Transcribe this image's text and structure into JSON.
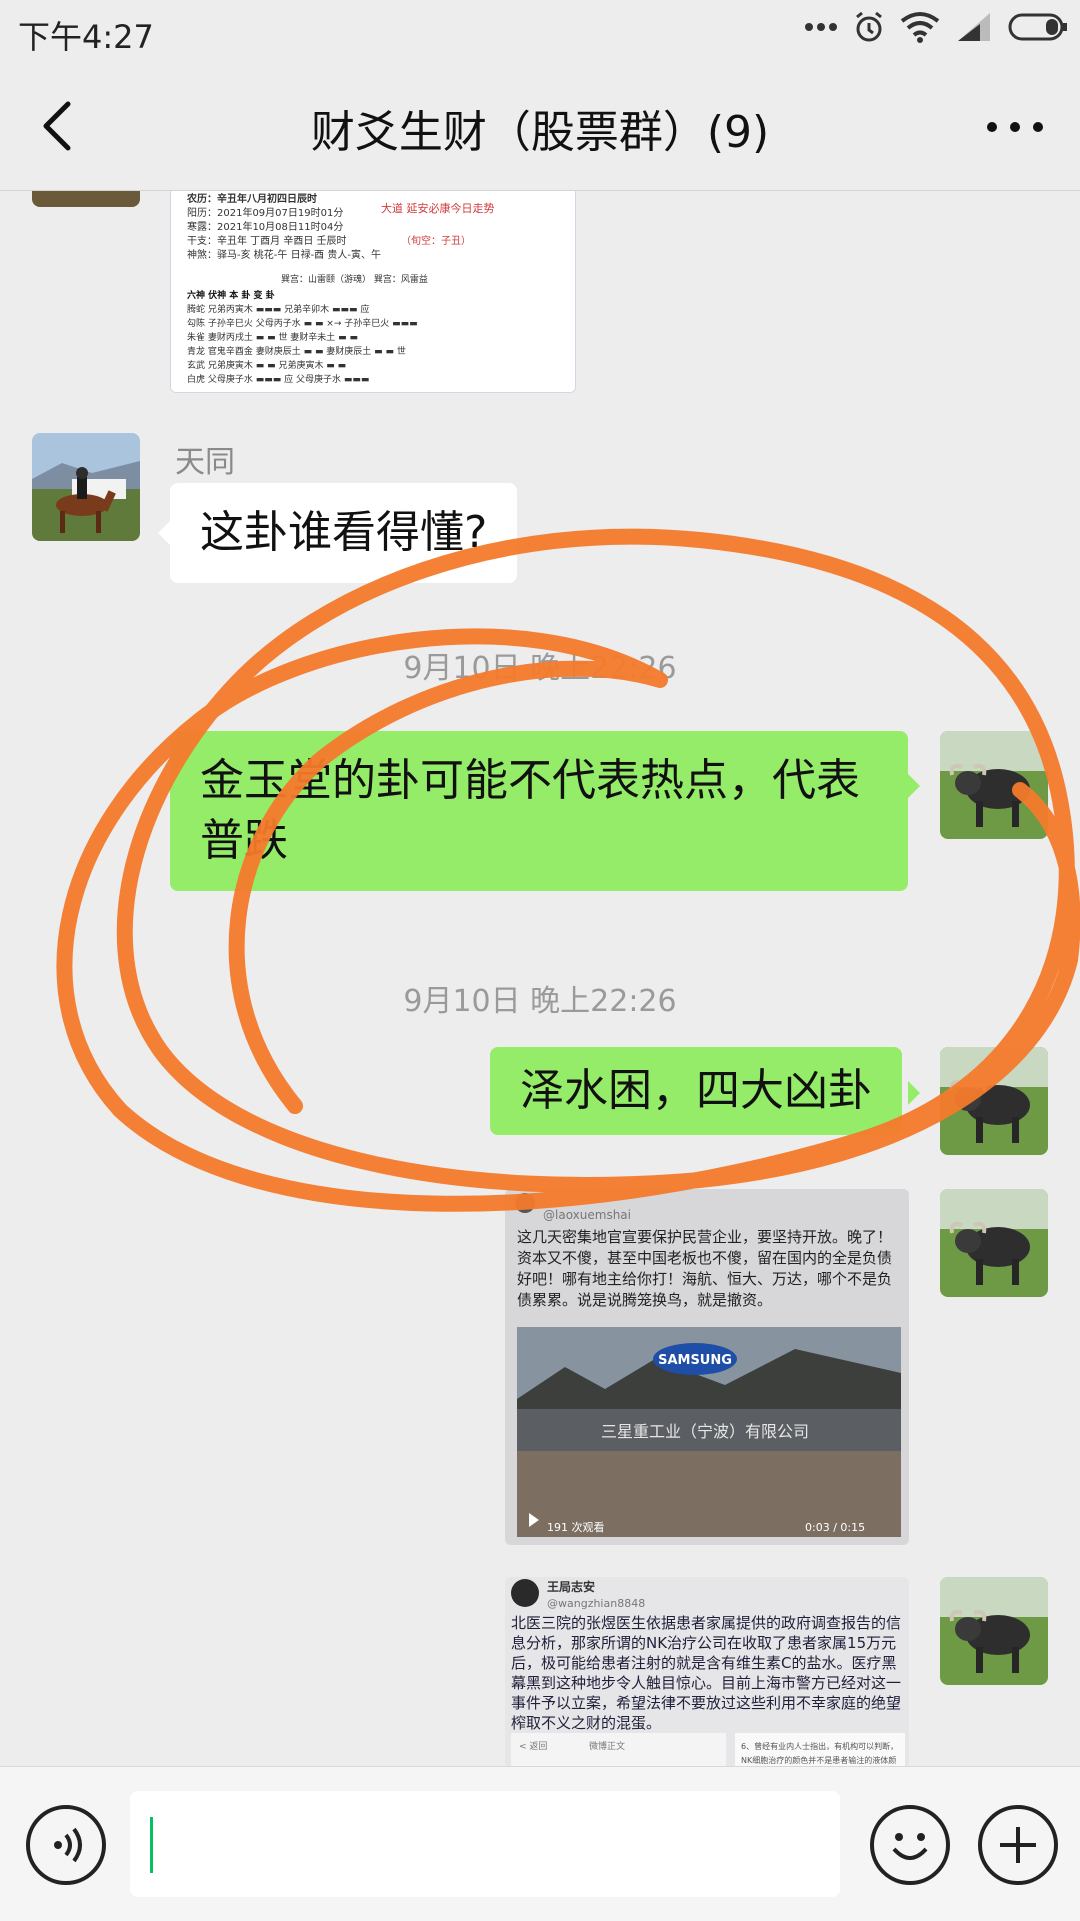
{
  "status_bar": {
    "time": "下午4:27"
  },
  "header": {
    "title": "财爻生财（股票群）(9)"
  },
  "messages": {
    "m1_sender": "天同",
    "m1_text": "这卦谁看得懂?",
    "ts1": "9月10日 晚上22:26",
    "m2_text": "金玉堂的卦可能不代表热点，代表普跌",
    "ts2": "9月10日 晚上22:26",
    "m3_text": "泽水困，四大凶卦"
  },
  "card1": {
    "l1": "农历：辛丑年八月初四日辰时",
    "l2": "阳历：2021年09月07日19时01分",
    "l3": "寒露：2021年10月08日11时04分",
    "l4": "干支：辛丑年 丁酉月 辛酉日 壬辰时",
    "l5": "神煞：驿马-亥 桃花-午 日禄-酉 贵人-寅、午",
    "red1": "大道 延安必康今日走势",
    "red2": "（旬空：子丑）",
    "palace": "巽宫：山雷颐（游魂）      巽宫：风雷益",
    "cols": "六神   伏神    本   卦          变   卦",
    "rows": [
      "腾蛇      兄弟丙寅木 ▬▬▬      兄弟辛卯木 ▬▬▬ 应",
      "勾陈 子孙辛巳火 父母丙子水 ▬ ▬  ×→ 子孙辛巳火 ▬▬▬",
      "朱雀      妻财丙戌土 ▬ ▬ 世    妻财辛未土 ▬ ▬",
      "青龙 官鬼辛酉金 妻财庚辰土 ▬ ▬     妻财庚辰土 ▬ ▬ 世",
      "玄武      兄弟庚寅木 ▬ ▬      兄弟庚寅木 ▬ ▬",
      "白虎      父母庚子水 ▬▬▬ 应    父母庚子水 ▬▬▬"
    ]
  },
  "card2": {
    "handle": "@laoxuemshai",
    "text": "这几天密集地官宣要保护民营企业，要坚持开放。晚了！资本又不傻，甚至中国老板也不傻，留在国内的全是负债好吧！哪有地主给你打！海航、恒大、万达，哪个不是负债累累。说是说腾笼换鸟，就是撤资。",
    "logo": "SAMSUNG",
    "sign": "三星重工业（宁波）有限公司",
    "views": "191 次观看",
    "duration": "0:03 / 0:15"
  },
  "card3": {
    "name": "王局志安",
    "handle": "@wangzhian8848",
    "text": "北医三院的张煜医生依据患者家属提供的政府调查报告的信息分析，那家所谓的NK治疗公司在收取了患者家属15万元后，极可能给患者注射的就是含有维生素C的盐水。医疗黑幕黑到这种地步令人触目惊心。目前上海市警方已经对这一事件予以立案，希望法律不要放过这些利用不幸家庭的绝望榨取不义之财的混蛋。",
    "back": "< 返回",
    "footer": "微博正文",
    "note1": "6、曾经有业内人士指出，有机构可以判断，",
    "note2": "NK细胞治疗的颜色并不是患者输注的液体颜"
  },
  "colors": {
    "accent": "#07c160",
    "bubble_me": "#95ec69",
    "annotation": "#f47a2c"
  },
  "icons": [
    "back-arrow-icon",
    "more-icon",
    "voice-icon",
    "emoji-icon",
    "plus-icon"
  ]
}
